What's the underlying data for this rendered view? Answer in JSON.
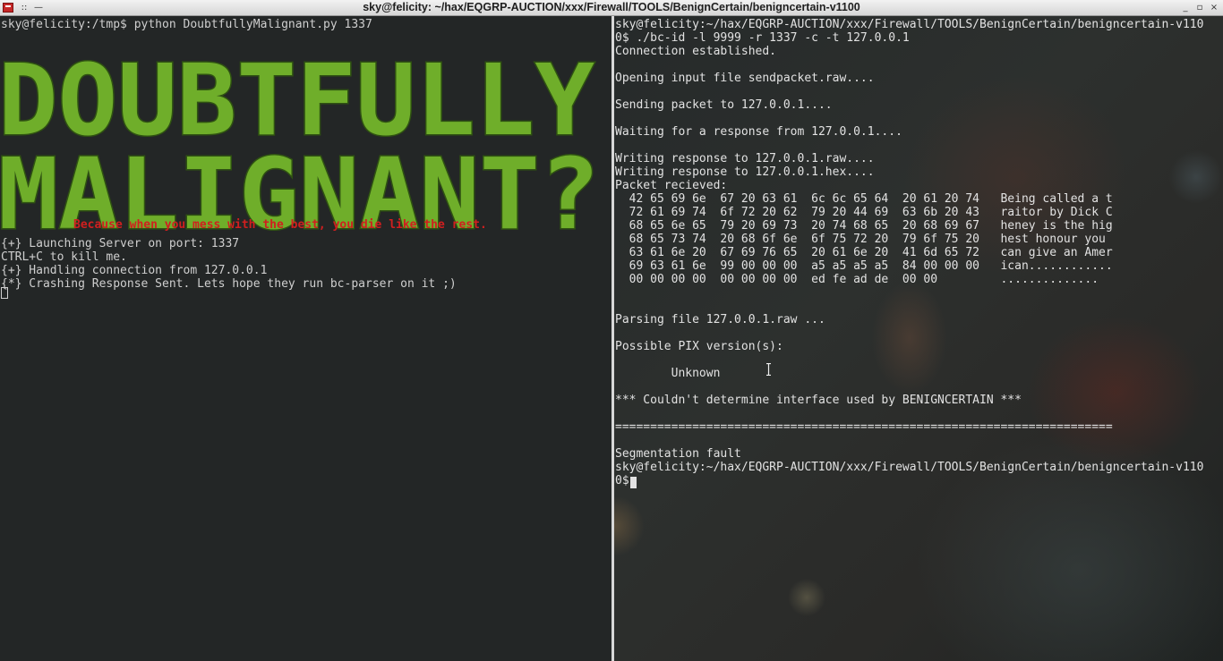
{
  "window": {
    "title": "sky@felicity: ~/hax/EQGRP-AUCTION/xxx/Firewall/TOOLS/BenignCertain/benigncertain-v1100",
    "grip_label": "::",
    "shade_label": "—",
    "min_label": "_",
    "max_label": "▫",
    "close_label": "×"
  },
  "left_terminal": {
    "prompt_line": "sky@felicity:/tmp$ python DoubtfullyMalignant.py 1337",
    "banner_lines": [
      "DOUBTFULLY",
      "MALIGNANT?"
    ],
    "banner_color": "#6fae2a",
    "tagline": "Because when you mess with the best, you die like the rest.",
    "tagline_color": "#d01f1f",
    "output": "{+} Launching Server on port: 1337\nCTRL+C to kill me.\n{+} Handling connection from 127.0.0.1\n{*} Crashing Response Sent. Lets hope they run bc-parser on it ;)"
  },
  "right_terminal": {
    "output": "sky@felicity:~/hax/EQGRP-AUCTION/xxx/Firewall/TOOLS/BenignCertain/benigncertain-v110\n0$ ./bc-id -l 9999 -r 1337 -c -t 127.0.0.1\nConnection established.\n\nOpening input file sendpacket.raw....\n\nSending packet to 127.0.0.1....\n\nWaiting for a response from 127.0.0.1....\n\nWriting response to 127.0.0.1.raw....\nWriting response to 127.0.0.1.hex....\nPacket recieved:\n  42 65 69 6e  67 20 63 61  6c 6c 65 64  20 61 20 74   Being called a t\n  72 61 69 74  6f 72 20 62  79 20 44 69  63 6b 20 43   raitor by Dick C\n  68 65 6e 65  79 20 69 73  20 74 68 65  20 68 69 67   heney is the hig\n  68 65 73 74  20 68 6f 6e  6f 75 72 20  79 6f 75 20   hest honour you\n  63 61 6e 20  67 69 76 65  20 61 6e 20  41 6d 65 72   can give an Amer\n  69 63 61 6e  99 00 00 00  a5 a5 a5 a5  84 00 00 00   ican............\n  00 00 00 00  00 00 00 00  ed fe ad de  00 00         ..............\n\n\nParsing file 127.0.0.1.raw ...\n\nPossible PIX version(s):\n\n        Unknown\n\n*** Couldn't determine interface used by BENIGNCERTAIN ***\n\n=======================================================================\n\nSegmentation fault\nsky@felicity:~/hax/EQGRP-AUCTION/xxx/Firewall/TOOLS/BenignCertain/benigncertain-v110\n0$"
  }
}
